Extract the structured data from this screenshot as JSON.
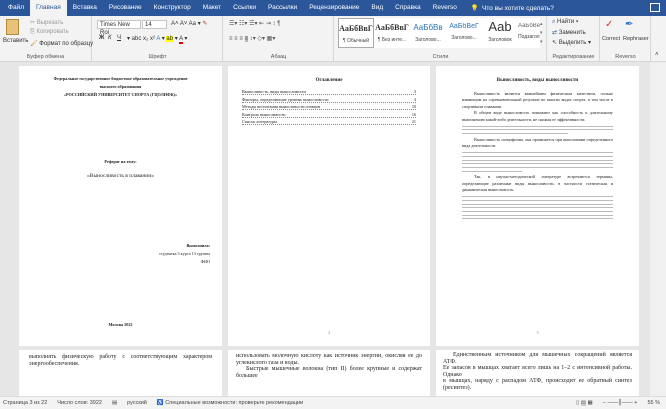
{
  "tabs": [
    "Файл",
    "Главная",
    "Вставка",
    "Рисование",
    "Конструктор",
    "Макет",
    "Ссылки",
    "Рассылки",
    "Рецензирование",
    "Вид",
    "Справка",
    "Reverso"
  ],
  "tell_me": "Что вы хотите сделать?",
  "clipboard": {
    "paste": "Вставить",
    "cut": "Вырезать",
    "copy": "Копировать",
    "format_painter": "Формат по образцу",
    "label": "Буфер обмена"
  },
  "font": {
    "name": "Times New Roi",
    "size": "14",
    "label": "Шрифт",
    "bold": "Ж",
    "italic": "К",
    "underline": "Ч"
  },
  "paragraph": {
    "label": "Абзац"
  },
  "styles": {
    "label": "Стили",
    "items": [
      {
        "sample": "АаБбВвГ",
        "name": "¶ Обычный"
      },
      {
        "sample": "АаБбВвГ",
        "name": "¶ Без инте..."
      },
      {
        "sample": "АаБбВв",
        "name": "Заголово..."
      },
      {
        "sample": "АаБбВеГ",
        "name": "Заголово..."
      },
      {
        "sample": "Aab",
        "name": "Заголовок"
      },
      {
        "sample": "АаБбВеГ",
        "name": "Подзагол..."
      }
    ]
  },
  "editing": {
    "find": "Найти",
    "replace": "Заменить",
    "select": "Выделить",
    "label": "Редактирование"
  },
  "reverso": {
    "correct": "Correct",
    "rephraser": "Rephraser",
    "label": "Reverso"
  },
  "page1": {
    "org1": "Федеральное государственное бюджетное образовательное учреждение",
    "org2": "высшего образования",
    "org3": "«РОССИЙСКИЙ УНИВЕРСИТЕТ СПОРТА (ГЦОЛИФК)»",
    "ref": "Реферат на тему:",
    "topic": "«Выносливость в плавании»",
    "done": "Выполнила:",
    "student": "студентка 3 курса 13 группы",
    "fio": "ФИО",
    "city": "Москва 2022"
  },
  "page2": {
    "title": "Оглавление",
    "toc": [
      {
        "t": "Выносливость, виды выносливости",
        "p": "3"
      },
      {
        "t": "Факторы, определяющие уровень выносливости",
        "p": "4"
      },
      {
        "t": "Методы воспитания выносливости пловцов",
        "p": "10"
      },
      {
        "t": "Контроль выносливости",
        "p": "16"
      },
      {
        "t": "Список литературы",
        "p": "21"
      }
    ],
    "num": "2"
  },
  "page3": {
    "title": "Выносливость, виды выносливости",
    "p1": "Выносливость является важнейшим физическим качеством, сильно влияющим на соревновательный результат во многих видах спорта, в том числе в спортивном плавании.",
    "p2": "В общем виде выносливость понимают как способность к длительному выполнению какой-либо деятельности, не снижая ее эффективности.",
    "p3": "Выносливость специфична, она проявляется при выполнении определенного вида деятельности.",
    "p4": "Так, в научно-методической литературе встречаются термины, определяющие различные виды выносливости, в частности статическая и динамическая выносливость.",
    "num": "3"
  },
  "row2": {
    "a1": "выполнять физическую работу с соответствующим характером энергообеспечения.",
    "b1": "использовать молочную кислоту как источник энергии, окисляя ее до углекислого газа и воды.",
    "b2": "Быстрые мышечные волокна (тип II) более крупные и содержат большее",
    "c1": "Единственным источником для мышечных сокращений является АТФ.",
    "c2": "Ее запасов в мышцах хватает всего лишь на 1–2 с интенсивной работы. Однако",
    "c3": "в мышцах, наряду с распадом АТФ, происходит ее обратный синтез (ресинтез)."
  },
  "status": {
    "page": "Страница 3 из 22",
    "words": "Число слов: 3922",
    "lang": "русский",
    "access": "Специальные возможности: проверьте рекомендации",
    "zoom": "55 %"
  }
}
